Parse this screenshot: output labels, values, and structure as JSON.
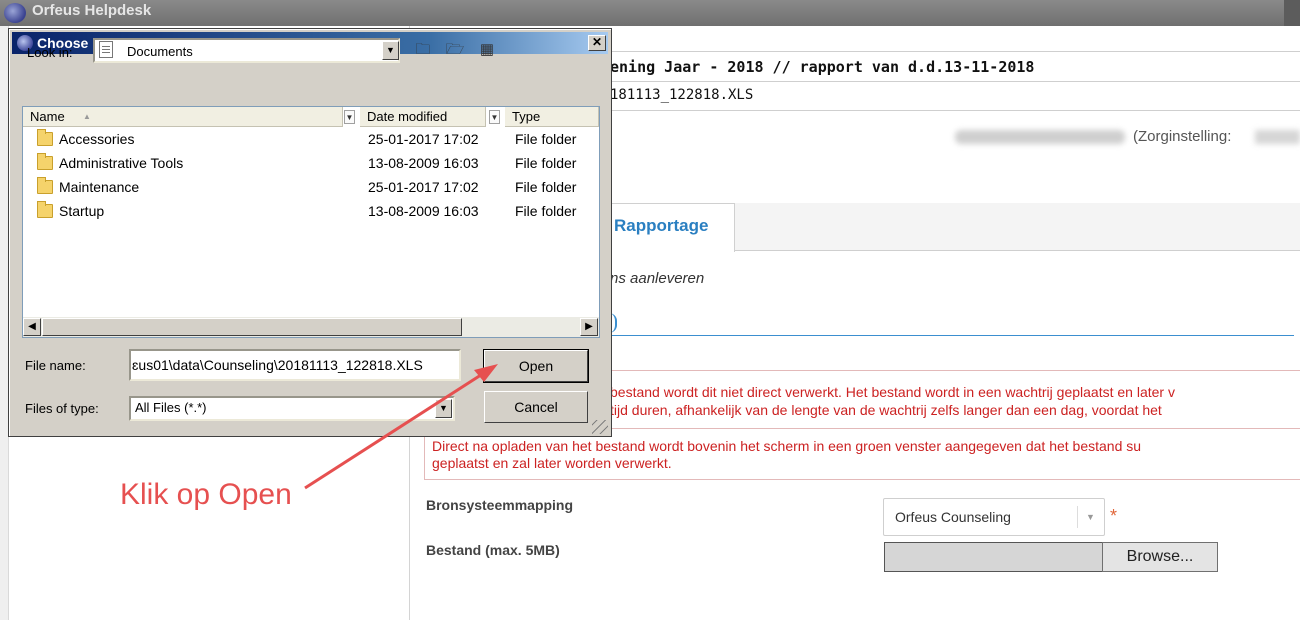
{
  "app": {
    "title": "Orfeus Helpdesk"
  },
  "report": {
    "title": "ening Jaar - 2018 // rapport van d.d.13-11-2018",
    "filename": "181113_122818.XLS"
  },
  "user": {
    "org_label": "(Zorginstelling:"
  },
  "tabs": {
    "active_label": "Rapportage"
  },
  "section": {
    "italic_text": "ns aanleveren"
  },
  "notice": {
    "line1": "bestand wordt dit niet direct verwerkt. Het bestand wordt in een wachtrij geplaatst en later v",
    "line2": "tijd duren, afhankelijk van de lengte van de wachtrij zelfs langer dan een dag, voordat het",
    "line3": "Direct na opladen van het bestand wordt bovenin het scherm in een groen venster aangegeven dat het bestand su",
    "line4": "geplaatst en zal later worden verwerkt."
  },
  "form": {
    "mapping_label": "Bronsysteemmapping",
    "mapping_value": "Orfeus Counseling",
    "file_label": "Bestand (max. 5MB)",
    "browse_label": "Browse...",
    "required_mark": "*"
  },
  "annotation": {
    "text": "Klik op Open",
    "color": "#e65050"
  },
  "dialog": {
    "title": "Choose File to Upload",
    "close_glyph": "✕",
    "look_in_label": "Look in:",
    "look_in_value": "Documents",
    "columns": [
      "Name",
      "Date modified",
      "Type"
    ],
    "files": [
      {
        "name": "Accessories",
        "modified": "25-01-2017 17:02",
        "type": "File folder"
      },
      {
        "name": "Administrative Tools",
        "modified": "13-08-2009 16:03",
        "type": "File folder"
      },
      {
        "name": "Maintenance",
        "modified": "25-01-2017 17:02",
        "type": "File folder"
      },
      {
        "name": "Startup",
        "modified": "13-08-2009 16:03",
        "type": "File folder"
      }
    ],
    "file_name_label": "File name:",
    "file_name_value": "ɛus01\\data\\Counseling\\20181113_122818.XLS",
    "files_of_type_label": "Files of type:",
    "files_of_type_value": "All Files (*.*)",
    "open_label": "Open",
    "cancel_label": "Cancel"
  }
}
